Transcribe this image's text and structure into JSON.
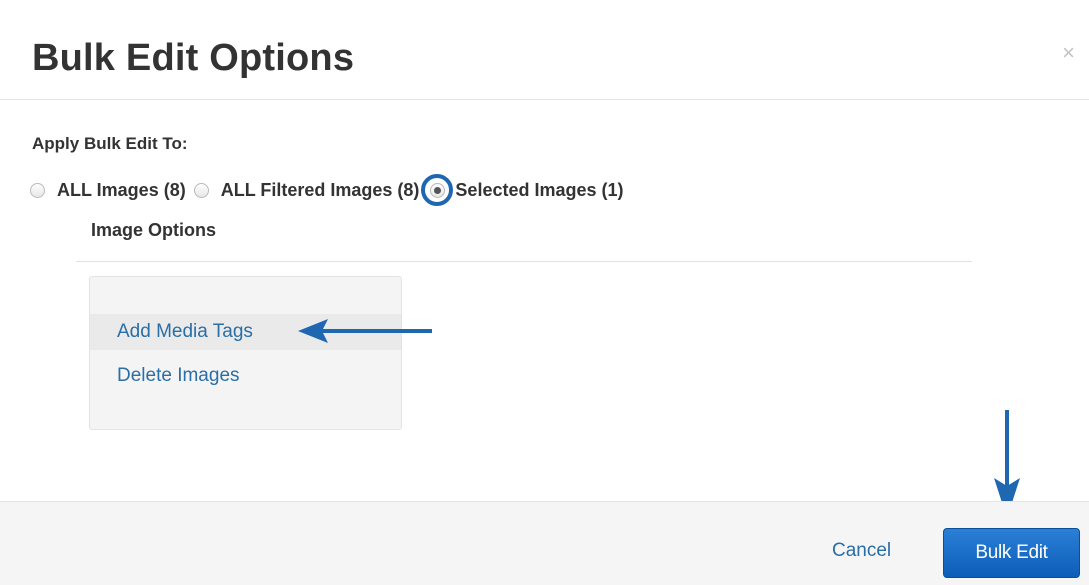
{
  "modal": {
    "title": "Bulk Edit Options",
    "close_symbol": "×",
    "close_icon": "close-icon"
  },
  "apply": {
    "label": "Apply Bulk Edit To:",
    "options": [
      {
        "label": "ALL Images (8)",
        "checked": false
      },
      {
        "label": "ALL Filtered Images (8)",
        "checked": false
      },
      {
        "label": "Selected Images (1)",
        "checked": true
      }
    ]
  },
  "image_options": {
    "title": "Image Options",
    "items": [
      {
        "label": "Add Media Tags",
        "highlighted": true
      },
      {
        "label": "Delete Images",
        "highlighted": false
      }
    ]
  },
  "footer": {
    "cancel_label": "Cancel",
    "bulk_edit_label": "Bulk Edit"
  },
  "colors": {
    "link": "#2a6ea6",
    "primary_button": "#0c5db8",
    "annotation": "#1f67b1",
    "footer_bg": "#f5f5f5"
  }
}
